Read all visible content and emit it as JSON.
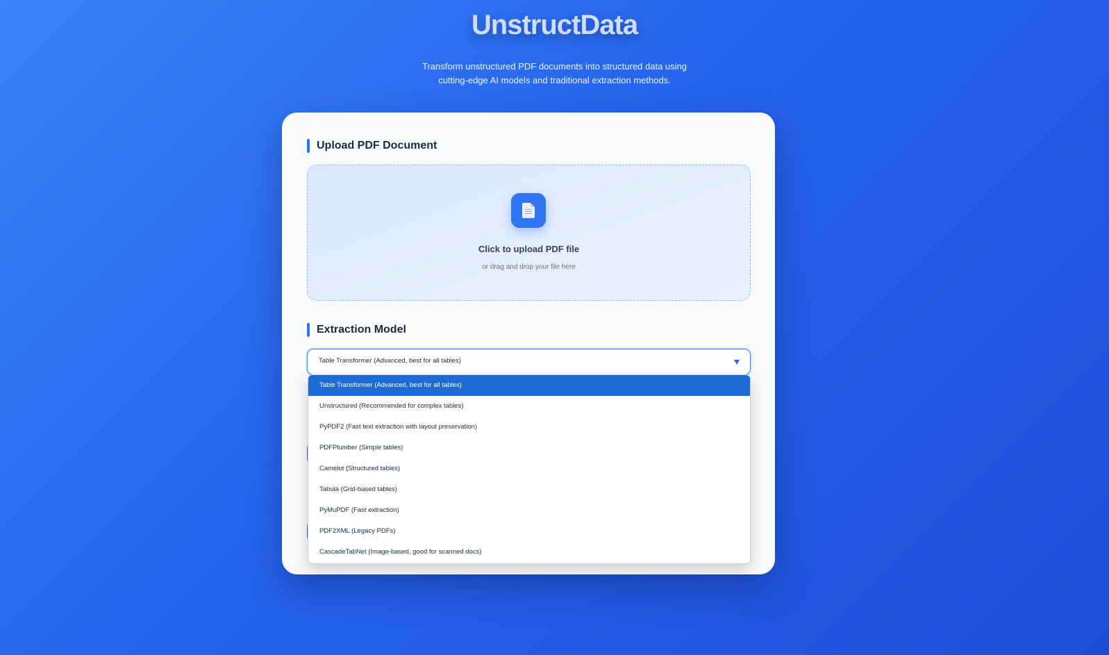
{
  "header": {
    "title": "UnstructData",
    "subtitle_line1": "Transform unstructured PDF documents into structured data using",
    "subtitle_line2": "cutting-edge AI models and traditional extraction methods."
  },
  "upload": {
    "heading": "Upload PDF Document",
    "icon": "document-icon",
    "title": "Click to upload PDF file",
    "hint": "or drag and drop your file here"
  },
  "model": {
    "heading": "Extraction Model",
    "selected": "Table Transformer (Advanced, best for all tables)",
    "options": [
      "Table Transformer (Advanced, best for all tables)",
      "Unstructured (Recommended for complex tables)",
      "PyPDF2 (Fast text extraction with layout preservation)",
      "PDFPlumber (Simple tables)",
      "Camelot (Structured tables)",
      "Tabula (Grid-based tables)",
      "PyMuPDF (Fast extraction)",
      "PDF2XML (Legacy PDFs)",
      "CascadeTabNet (Image-based, good for scanned docs)"
    ]
  },
  "colors": {
    "accent": "#2f74f0",
    "selected_option": "#1d6cd5"
  }
}
